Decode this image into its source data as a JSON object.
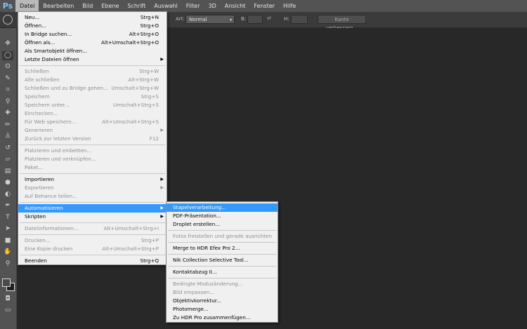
{
  "app": {
    "logo": "Ps"
  },
  "menubar": [
    "Datei",
    "Bearbeiten",
    "Bild",
    "Ebene",
    "Schrift",
    "Auswahl",
    "Filter",
    "3D",
    "Ansicht",
    "Fenster",
    "Hilfe"
  ],
  "options": {
    "art_label": "Art:",
    "art_value": "Normal",
    "b_label": "B:",
    "h_label": "H:",
    "refine_button": "Kante verbessern..."
  },
  "file_menu": [
    {
      "label": "Neu...",
      "shortcut": "Strg+N"
    },
    {
      "label": "Öffnen...",
      "shortcut": "Strg+O"
    },
    {
      "label": "In Bridge suchen...",
      "shortcut": "Alt+Strg+O"
    },
    {
      "label": "Öffnen als...",
      "shortcut": "Alt+Umschalt+Strg+O"
    },
    {
      "label": "Als Smartobjekt öffnen..."
    },
    {
      "label": "Letzte Dateien öffnen",
      "submenu": true
    },
    {
      "sep": true
    },
    {
      "label": "Schließen",
      "shortcut": "Strg+W",
      "disabled": true
    },
    {
      "label": "Alle schließen",
      "shortcut": "Alt+Strg+W",
      "disabled": true
    },
    {
      "label": "Schließen und zu Bridge gehen...",
      "shortcut": "Umschalt+Strg+W",
      "disabled": true
    },
    {
      "label": "Speichern",
      "shortcut": "Strg+S",
      "disabled": true
    },
    {
      "label": "Speichern unter...",
      "shortcut": "Umschalt+Strg+S",
      "disabled": true
    },
    {
      "label": "Einchecken...",
      "disabled": true
    },
    {
      "label": "Für Web speichern...",
      "shortcut": "Alt+Umschalt+Strg+S",
      "disabled": true
    },
    {
      "label": "Generieren",
      "submenu": true,
      "disabled": true
    },
    {
      "label": "Zurück zur letzten Version",
      "shortcut": "F12",
      "disabled": true
    },
    {
      "sep": true
    },
    {
      "label": "Platzieren und einbetten...",
      "disabled": true
    },
    {
      "label": "Platzieren und verknüpfen...",
      "disabled": true
    },
    {
      "label": "Paket...",
      "disabled": true
    },
    {
      "sep": true
    },
    {
      "label": "Importieren",
      "submenu": true
    },
    {
      "label": "Exportieren",
      "submenu": true,
      "disabled": true
    },
    {
      "label": "Auf Behance teilen...",
      "disabled": true
    },
    {
      "sep": true
    },
    {
      "label": "Automatisieren",
      "submenu": true,
      "highlighted": true
    },
    {
      "label": "Skripten",
      "submenu": true
    },
    {
      "sep": true
    },
    {
      "label": "Dateiinformationen...",
      "shortcut": "Alt+Umschalt+Strg+I",
      "disabled": true
    },
    {
      "sep": true
    },
    {
      "label": "Drucken...",
      "shortcut": "Strg+P",
      "disabled": true
    },
    {
      "label": "Eine Kopie drucken",
      "shortcut": "Alt+Umschalt+Strg+P",
      "disabled": true
    },
    {
      "sep": true
    },
    {
      "label": "Beenden",
      "shortcut": "Strg+Q"
    }
  ],
  "automate_menu": [
    {
      "label": "Stapelverarbeitung...",
      "highlighted": true
    },
    {
      "label": "PDF-Präsentation..."
    },
    {
      "label": "Droplet erstellen..."
    },
    {
      "sep": true
    },
    {
      "label": "Fotos freistellen und gerade ausrichten",
      "disabled": true
    },
    {
      "sep": true
    },
    {
      "label": "Merge to HDR Efex Pro 2..."
    },
    {
      "sep": true
    },
    {
      "label": "Nik Collection Selective Tool..."
    },
    {
      "sep": true
    },
    {
      "label": "Kontaktabzug II..."
    },
    {
      "sep": true
    },
    {
      "label": "Bedingte Modusänderung...",
      "disabled": true
    },
    {
      "label": "Bild einpassen...",
      "disabled": true
    },
    {
      "label": "Objektivkorrektur..."
    },
    {
      "label": "Photomerge..."
    },
    {
      "label": "Zu HDR Pro zusammenfügen..."
    }
  ],
  "tools": [
    "move-tool",
    "marquee-tool",
    "lasso-tool",
    "quick-select-tool",
    "crop-tool",
    "eyedropper-tool",
    "healing-tool",
    "brush-tool",
    "stamp-tool",
    "history-brush-tool",
    "eraser-tool",
    "gradient-tool",
    "blur-tool",
    "dodge-tool",
    "pen-tool",
    "type-tool",
    "path-select-tool",
    "shape-tool",
    "hand-tool",
    "zoom-tool"
  ]
}
